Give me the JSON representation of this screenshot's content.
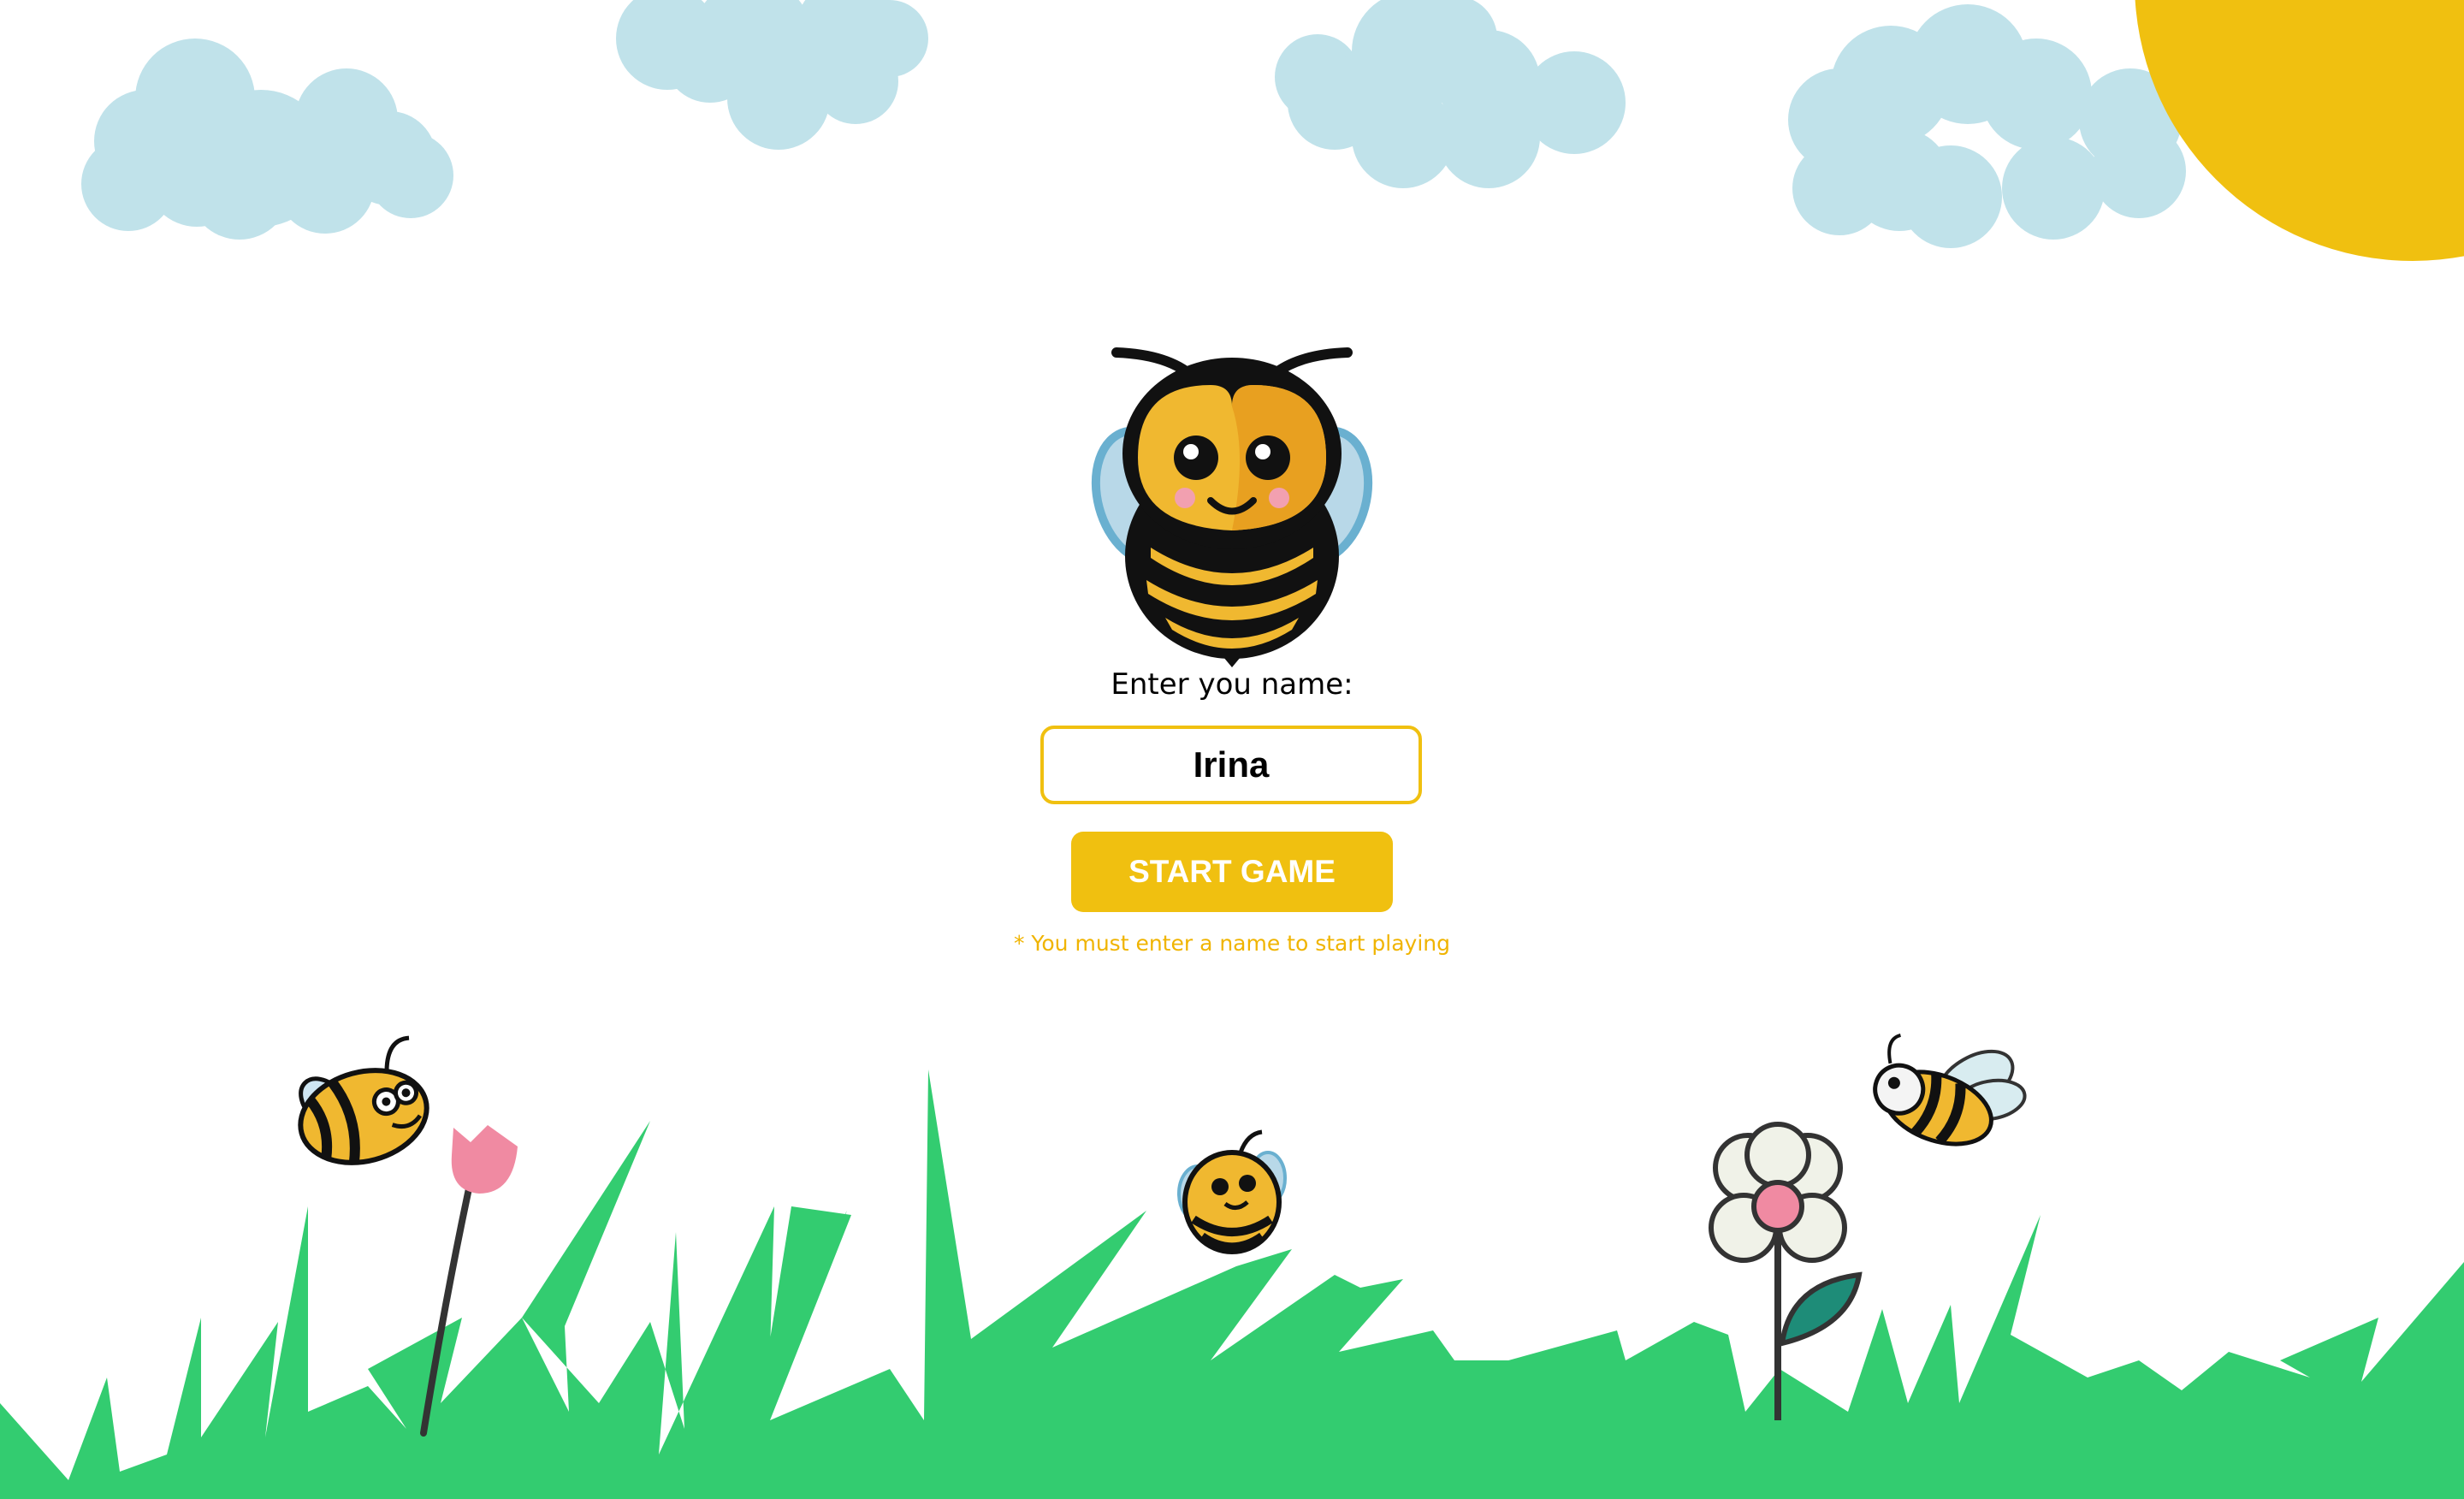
{
  "colors": {
    "sky_cloud": "#c0e2ea",
    "sun": "#f0c010",
    "grass": "#33cc70",
    "accent": "#f0c010",
    "hint_text": "#f0b400",
    "button_text": "#ffffff",
    "bee_body": "#111111",
    "bee_yellow": "#f0b830",
    "bee_wing": "#b8d8e8",
    "tulip": "#f08aa2",
    "flower_center": "#f08aa2",
    "flower_petal": "#f0f2e8",
    "leaf": "#1e8c78"
  },
  "decor": {
    "icons": [
      "cloud-icon",
      "sun-icon",
      "bee-mascot-icon",
      "bee-icon",
      "tulip-icon",
      "daisy-icon",
      "grass-icon"
    ]
  },
  "form": {
    "prompt_label": "Enter you name:",
    "name_value": "Irina",
    "start_label": "START GAME",
    "hint": "* You must enter a name to start playing"
  }
}
